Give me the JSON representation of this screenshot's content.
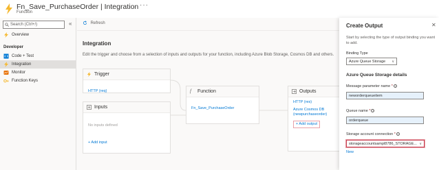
{
  "header": {
    "title": "Fn_Save_PurchaseOrder | Integration",
    "subtitle": "Function",
    "more_label": "···"
  },
  "sidebar": {
    "search_placeholder": "Search (Ctrl+/)",
    "collapse_label": "«",
    "overview_label": "Overview",
    "section_label": "Developer",
    "items": [
      {
        "label": "Code + Test",
        "icon": "code-icon"
      },
      {
        "label": "Integration",
        "icon": "integration-icon"
      },
      {
        "label": "Monitor",
        "icon": "monitor-icon"
      },
      {
        "label": "Function Keys",
        "icon": "key-icon"
      }
    ]
  },
  "toolbar": {
    "refresh_label": "Refresh"
  },
  "main": {
    "title": "Integration",
    "description": "Edit the trigger and choose from a selection of inputs and outputs for your function, including Azure Blob Storage, Cosmos DB and others.",
    "trigger": {
      "title": "Trigger",
      "link": "HTTP (req)"
    },
    "inputs": {
      "title": "Inputs",
      "empty": "No inputs defined",
      "add": "+ Add input"
    },
    "function": {
      "title": "Function",
      "link": "Fn_Save_PurchaseOrder"
    },
    "outputs": {
      "title": "Outputs",
      "items": [
        "HTTP (res)",
        "Azure Cosmos DB",
        "(newpurchaseorder)"
      ],
      "add": "+ Add output"
    }
  },
  "panel": {
    "title": "Create Output",
    "close_label": "✕",
    "description": "Start by selecting the type of output binding you want to add.",
    "binding_type_label": "Binding Type",
    "binding_type_value": "Azure Queue Storage",
    "section_title": "Azure Queue Storage details",
    "message_param_label": "Message parameter name",
    "message_param_value": "neworderqueueitem",
    "queue_name_label": "Queue name",
    "queue_name_value": "orderqueue",
    "storage_label": "Storage account connection",
    "storage_value": "storageaccountsampl8786_STORAGE...",
    "new_label": "New"
  },
  "colors": {
    "accent": "#0078d4",
    "function_icon": "#f5b82e",
    "highlight": "#c73e4f"
  }
}
